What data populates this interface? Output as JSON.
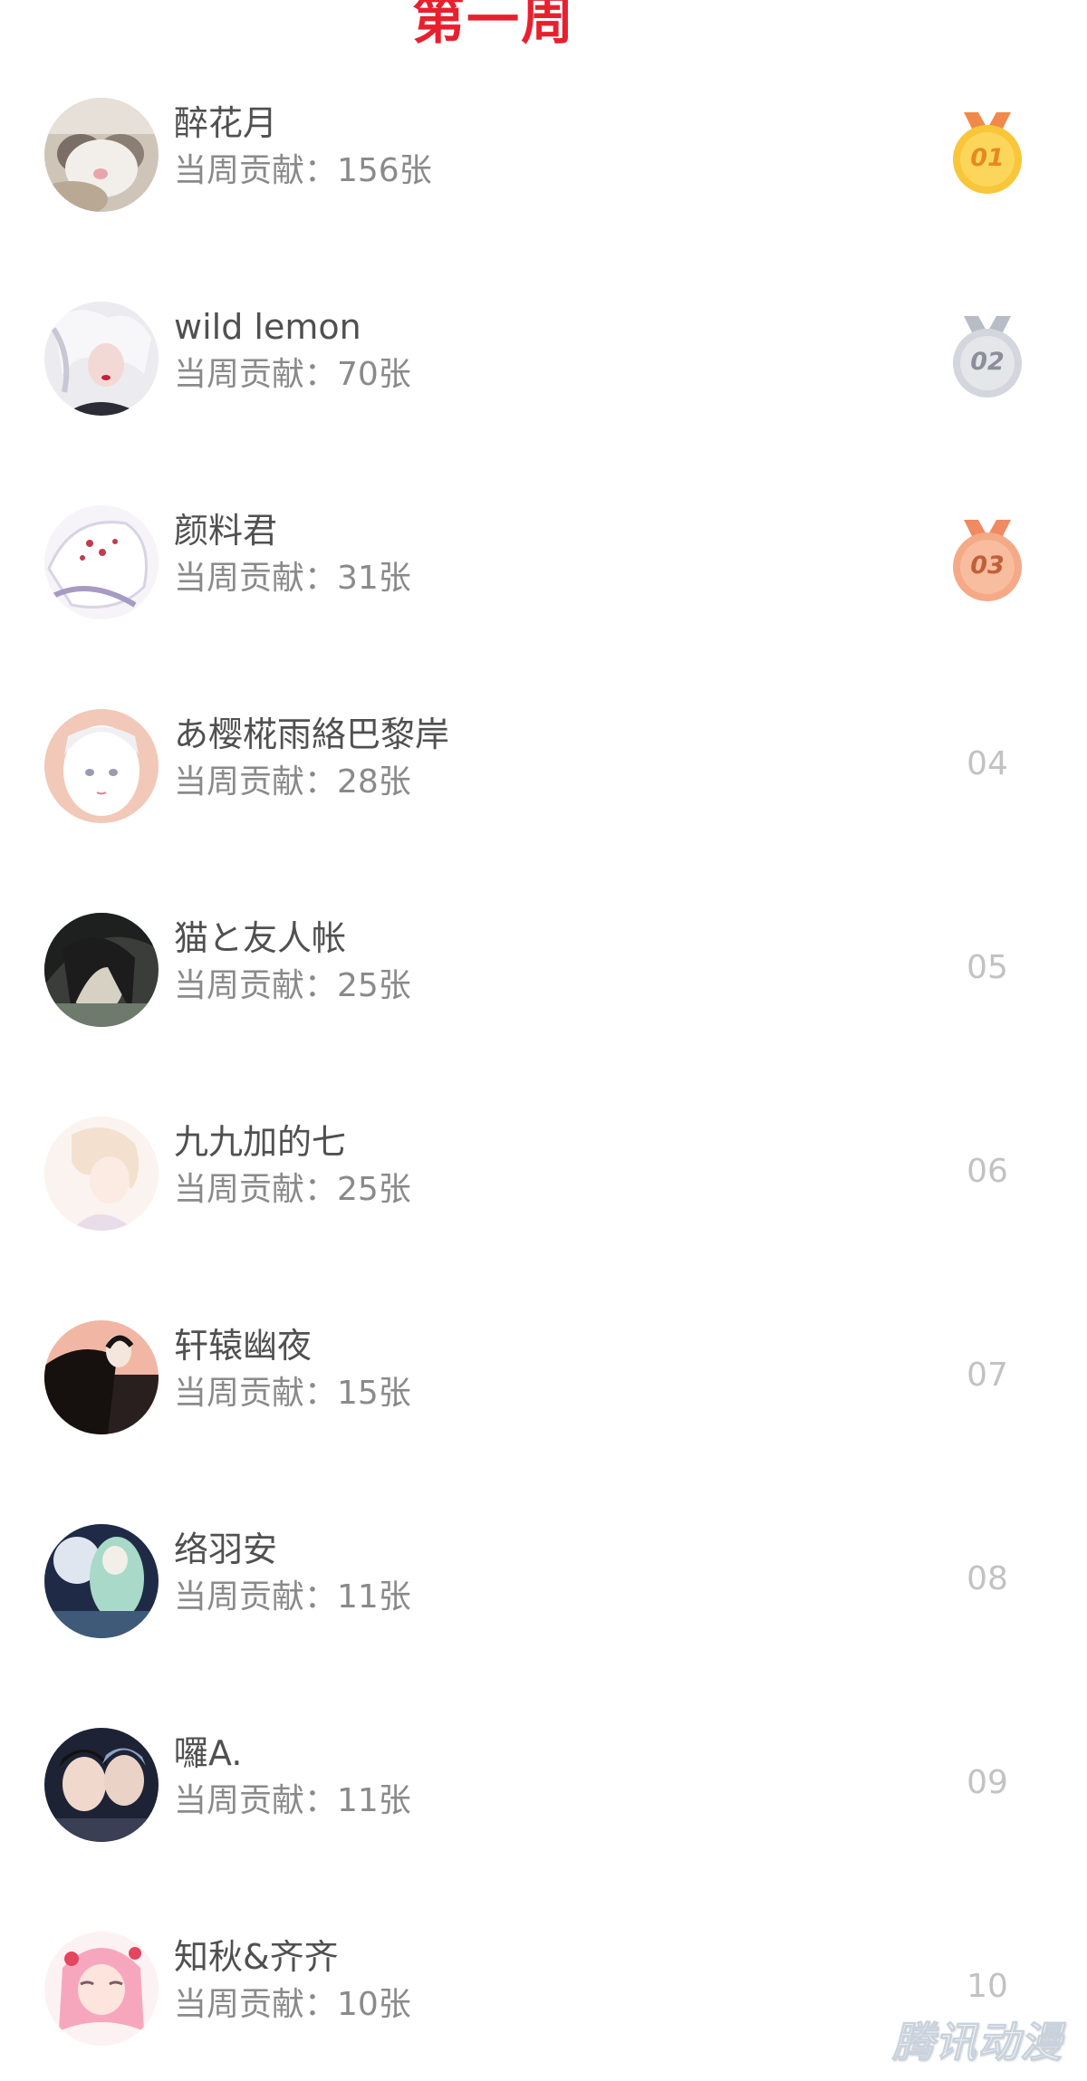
{
  "header": {
    "title": "第一周"
  },
  "ranking": [
    {
      "name": "醉花月",
      "contribution": "当周贡献：156张",
      "rank": "01",
      "medal": "gold"
    },
    {
      "name": "wild lemon",
      "contribution": "当周贡献：70张",
      "rank": "02",
      "medal": "silver"
    },
    {
      "name": "颜料君",
      "contribution": "当周贡献：31张",
      "rank": "03",
      "medal": "bronze"
    },
    {
      "name": "あ樱椛雨絡巴黎岸",
      "contribution": "当周贡献：28张",
      "rank": "04"
    },
    {
      "name": "猫と友人帐",
      "contribution": "当周贡献：25张",
      "rank": "05"
    },
    {
      "name": "九九加的七",
      "contribution": "当周贡献：25张",
      "rank": "06"
    },
    {
      "name": "轩辕幽夜",
      "contribution": "当周贡献：15张",
      "rank": "07"
    },
    {
      "name": "络羽安",
      "contribution": "当周贡献：11张",
      "rank": "08"
    },
    {
      "name": "囉A.",
      "contribution": "当周贡献：11张",
      "rank": "09"
    },
    {
      "name": "知秋&齐齐",
      "contribution": "当周贡献：10张",
      "rank": "10"
    }
  ],
  "colors": {
    "title": "#e8202e",
    "name": "#505050",
    "contribution": "#8a8a8a",
    "rank_number": "#c2c2c2",
    "gold": "#f7b52a",
    "silver": "#c9ccd3",
    "bronze": "#f4a27a"
  },
  "watermark": "腾讯动漫"
}
